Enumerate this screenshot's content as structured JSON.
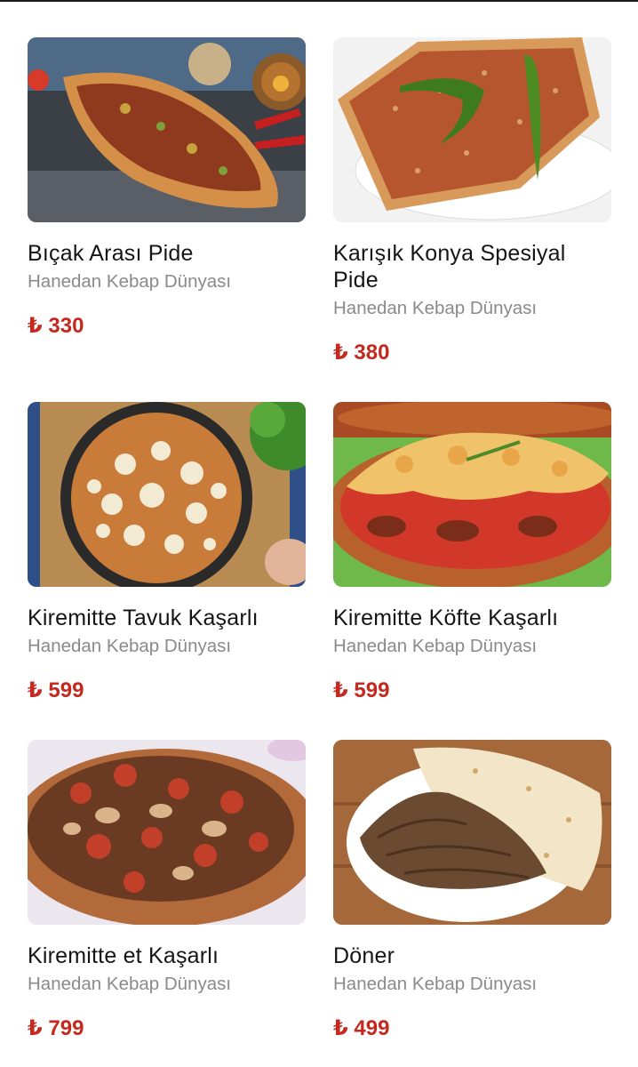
{
  "products": [
    {
      "title": "Bıçak Arası Pide",
      "vendor": "Hanedan Kebap Dünyası",
      "price": "₺ 330",
      "image_icon": "pide-with-meat-image"
    },
    {
      "title": "Karışık Konya Spesiyal Pide",
      "vendor": "Hanedan Kebap Dünyası",
      "price": "₺ 380",
      "image_icon": "konya-flat-pide-image"
    },
    {
      "title": "Kiremitte Tavuk Kaşarlı",
      "vendor": "Hanedan Kebap Dünyası",
      "price": "₺ 599",
      "image_icon": "chicken-cheese-pan-image"
    },
    {
      "title": "Kiremitte Köfte Kaşarlı",
      "vendor": "Hanedan Kebap Dünyası",
      "price": "₺ 599",
      "image_icon": "meatball-cheese-clay-dish-image"
    },
    {
      "title": "Kiremitte et Kaşarlı",
      "vendor": "Hanedan Kebap Dünyası",
      "price": "₺ 799",
      "image_icon": "meat-cheese-clay-dish-image"
    },
    {
      "title": "Döner",
      "vendor": "Hanedan Kebap Dünyası",
      "price": "₺ 499",
      "image_icon": "doner-wrap-image"
    }
  ],
  "colors": {
    "price": "#c3291f",
    "vendor": "#8a8a8a",
    "title": "#151515"
  }
}
